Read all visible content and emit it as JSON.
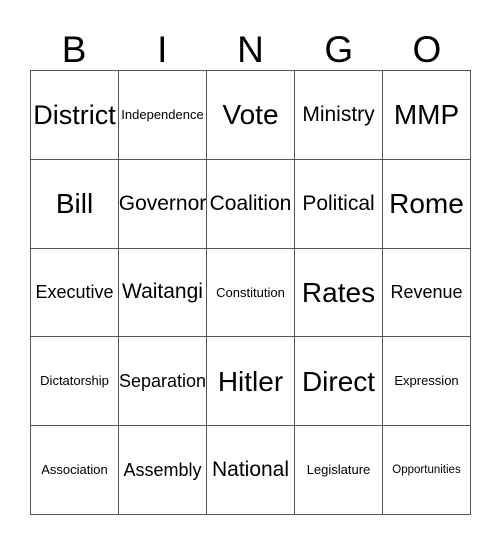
{
  "card": {
    "title": "BINGO",
    "header_letters": [
      "B",
      "I",
      "N",
      "G",
      "O"
    ],
    "grid_size": "5x5",
    "colors": {
      "background": "#ffffff",
      "text": "#000000",
      "gridline": "#555555"
    },
    "rows": [
      [
        {
          "text": "District",
          "size": "lg"
        },
        {
          "text": "Independence",
          "size": "xs"
        },
        {
          "text": "Vote",
          "size": "xl"
        },
        {
          "text": "Ministry",
          "size": "md"
        },
        {
          "text": "MMP",
          "size": "xl"
        }
      ],
      [
        {
          "text": "Bill",
          "size": "xl"
        },
        {
          "text": "Governor",
          "size": "md"
        },
        {
          "text": "Coalition",
          "size": "md"
        },
        {
          "text": "Political",
          "size": "md"
        },
        {
          "text": "Rome",
          "size": "xl"
        }
      ],
      [
        {
          "text": "Executive",
          "size": "sm"
        },
        {
          "text": "Waitangi",
          "size": "md"
        },
        {
          "text": "Constitution",
          "size": "xs"
        },
        {
          "text": "Rates",
          "size": "xl"
        },
        {
          "text": "Revenue",
          "size": "sm"
        }
      ],
      [
        {
          "text": "Dictatorship",
          "size": "xs"
        },
        {
          "text": "Separation",
          "size": "sm"
        },
        {
          "text": "Hitler",
          "size": "xl"
        },
        {
          "text": "Direct",
          "size": "xl"
        },
        {
          "text": "Expression",
          "size": "xs"
        }
      ],
      [
        {
          "text": "Association",
          "size": "xs"
        },
        {
          "text": "Assembly",
          "size": "sm"
        },
        {
          "text": "National",
          "size": "md"
        },
        {
          "text": "Legislature",
          "size": "xs"
        },
        {
          "text": "Opportunities",
          "size": "xxs"
        }
      ]
    ]
  }
}
